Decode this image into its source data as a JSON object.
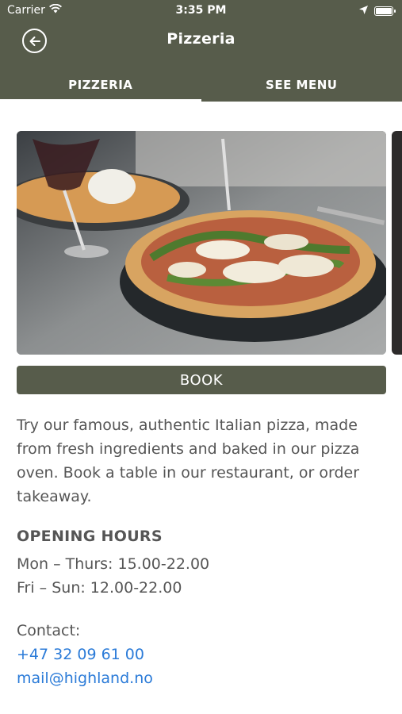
{
  "status_bar": {
    "carrier": "Carrier",
    "time": "3:35 PM"
  },
  "header": {
    "title": "Pizzeria",
    "back_icon": "back-arrow-circle-icon"
  },
  "tabs": [
    {
      "label": "PIZZERIA",
      "active": true
    },
    {
      "label": "SEE MENU",
      "active": false
    }
  ],
  "book_label": "BOOK",
  "description": "Try our famous, authentic Italian pizza, made from fresh ingredients and baked in our pizza oven. Book a table in our restaurant, or order takeaway.",
  "opening_hours": {
    "title": "OPENING HOURS",
    "lines": [
      "Mon – Thurs: 15.00-22.00",
      "Fri – Sun: 12.00-22.00"
    ]
  },
  "contact": {
    "label": "Contact:",
    "phone": "+47 32 09 61 00",
    "email": "mail@highland.no"
  },
  "colors": {
    "brand": "#575c4b",
    "link": "#2b7bd8",
    "text": "#555555"
  }
}
